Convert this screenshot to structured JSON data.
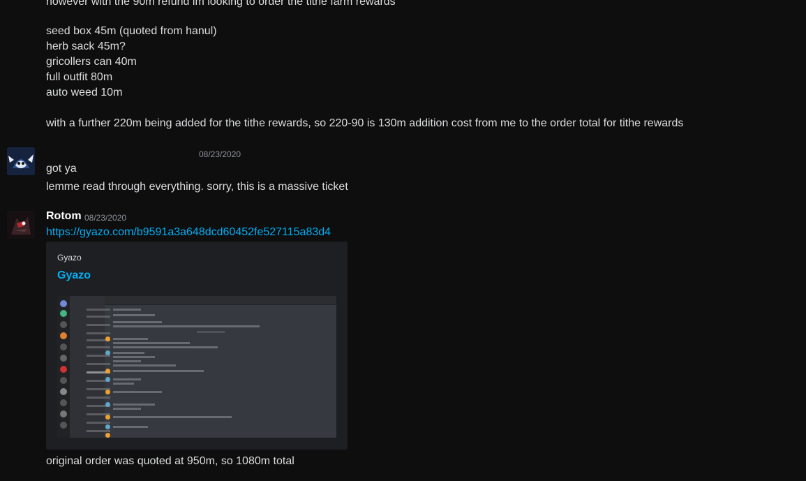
{
  "messages_top": {
    "partial_line": "however with the 90m refund im looking to order the tithe farm rewards",
    "items": [
      "seed box 45m  (quoted from hanul)",
      "herb sack 45m?",
      "gricollers can 40m",
      "full outfit 80m",
      "auto weed 10m"
    ],
    "summary": "with a further 220m being added for the tithe rewards, so 220-90 is 130m addition cost from me to the order total for tithe rewards"
  },
  "message_2": {
    "timestamp": "08/23/2020",
    "line1": "got ya",
    "line2": "lemme read through everything. sorry, this is a massive ticket"
  },
  "message_3": {
    "author": "Rotom",
    "timestamp": "08/23/2020",
    "link": "https://gyazo.com/b9591a3a648dcd60452fe527115a83d4",
    "embed": {
      "provider": "Gyazo",
      "title": "Gyazo"
    },
    "followup": "original order was quoted at 950m, so 1080m total"
  },
  "colors": {
    "background": "#0e0e0f",
    "text": "#dcddde",
    "link": "#00aff4",
    "embed": "#1e1f22"
  }
}
